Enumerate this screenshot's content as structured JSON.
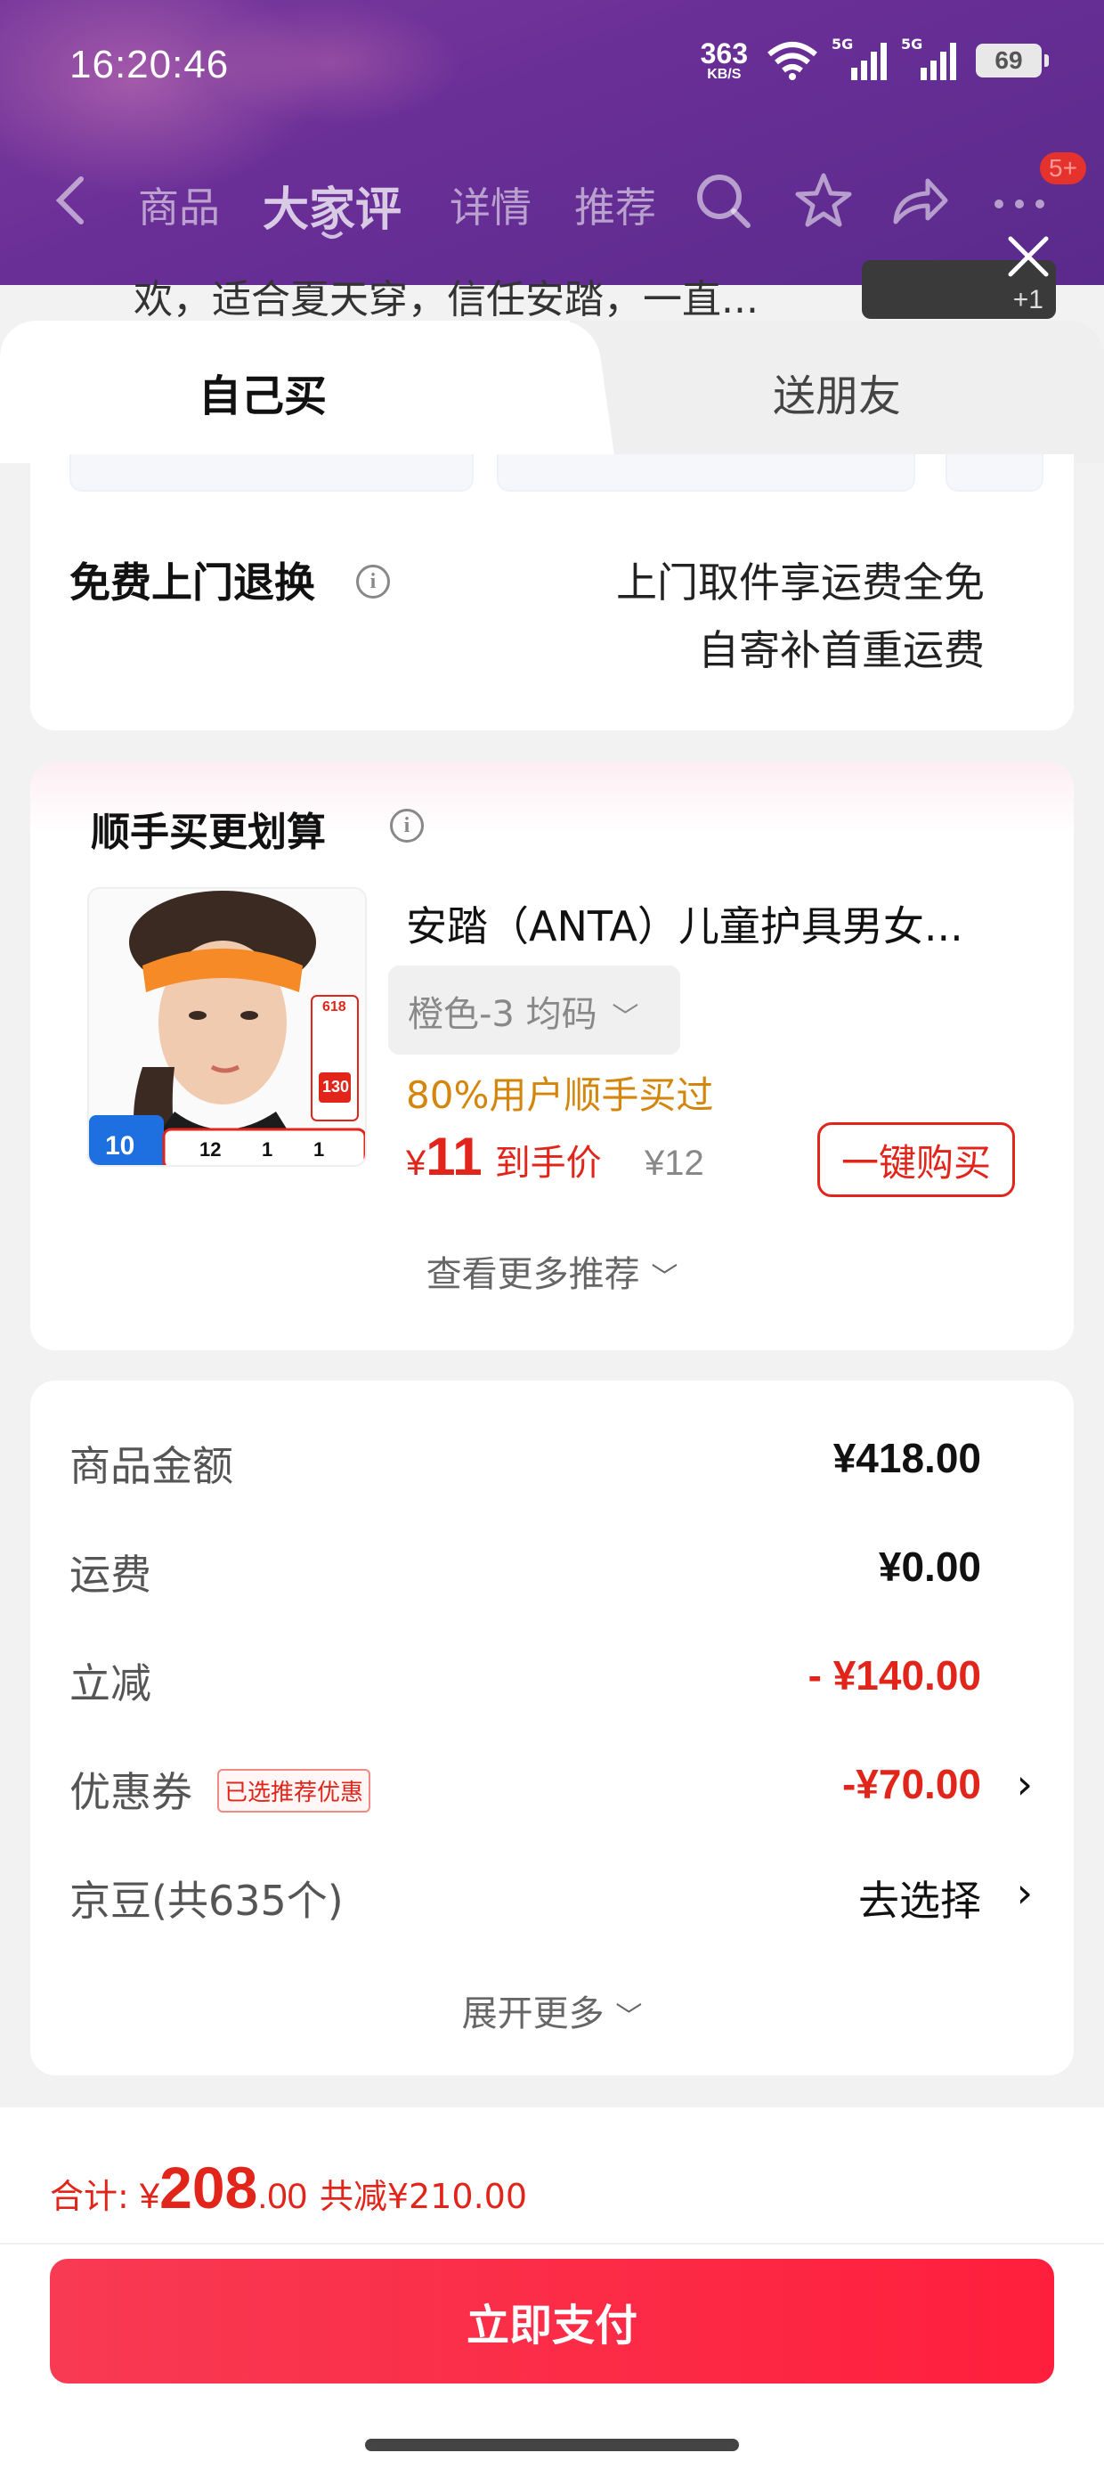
{
  "status_bar": {
    "time": "16:20:46",
    "net_speed": "363",
    "net_unit": "KB/S",
    "sig1_label": "5G",
    "sig2_label": "5G",
    "battery": "69"
  },
  "navbar": {
    "tabs": [
      "商品",
      "大家评",
      "详情",
      "推荐"
    ],
    "active_tab": "大家评",
    "badge": "5+"
  },
  "peek": {
    "review_text": "欢，适合夏天穿，信任安踏，一直...",
    "image_count": "+1"
  },
  "sheet_tabs": {
    "self": "自己买",
    "friend": "送朋友"
  },
  "return_card": {
    "title": "免费上门退换",
    "line1": "上门取件享运费全免",
    "line2": "自寄补首重运费"
  },
  "bundle_card": {
    "title": "顺手买更划算",
    "product_name": "安踏（ANTA）儿童护具男女...",
    "spec": "橙色-3   均码",
    "bought_pct": "80%用户顺手买过",
    "price_symbol": "¥",
    "price": "11",
    "price_label": "到手价",
    "orig_price": "¥12",
    "buy_button": "一键购买",
    "more": "查看更多推荐",
    "img_badge_num": "10",
    "img_countdown": [
      "12",
      "1",
      "1"
    ],
    "img_tag_top": "618",
    "img_price": "130"
  },
  "summary": {
    "rows": [
      {
        "label": "商品金额",
        "value": "¥418.00"
      },
      {
        "label": "运费",
        "value": "¥0.00"
      },
      {
        "label": "立减",
        "value": "- ¥140.00"
      },
      {
        "label": "优惠券",
        "value": "-¥70.00",
        "tag": "已选推荐优惠"
      },
      {
        "label": "京豆(共635个)",
        "value": "去选择"
      }
    ],
    "expand": "展开更多"
  },
  "bottom": {
    "total_label": "合计: ",
    "total_symbol": "¥",
    "total_int": "208",
    "total_dec": ".00",
    "discount": "共减¥210.00",
    "pay_button": "立即支付"
  },
  "colors": {
    "accent_red": "#e1251b",
    "purple_header": "#6a2f97",
    "orange_text": "#d4860c"
  }
}
